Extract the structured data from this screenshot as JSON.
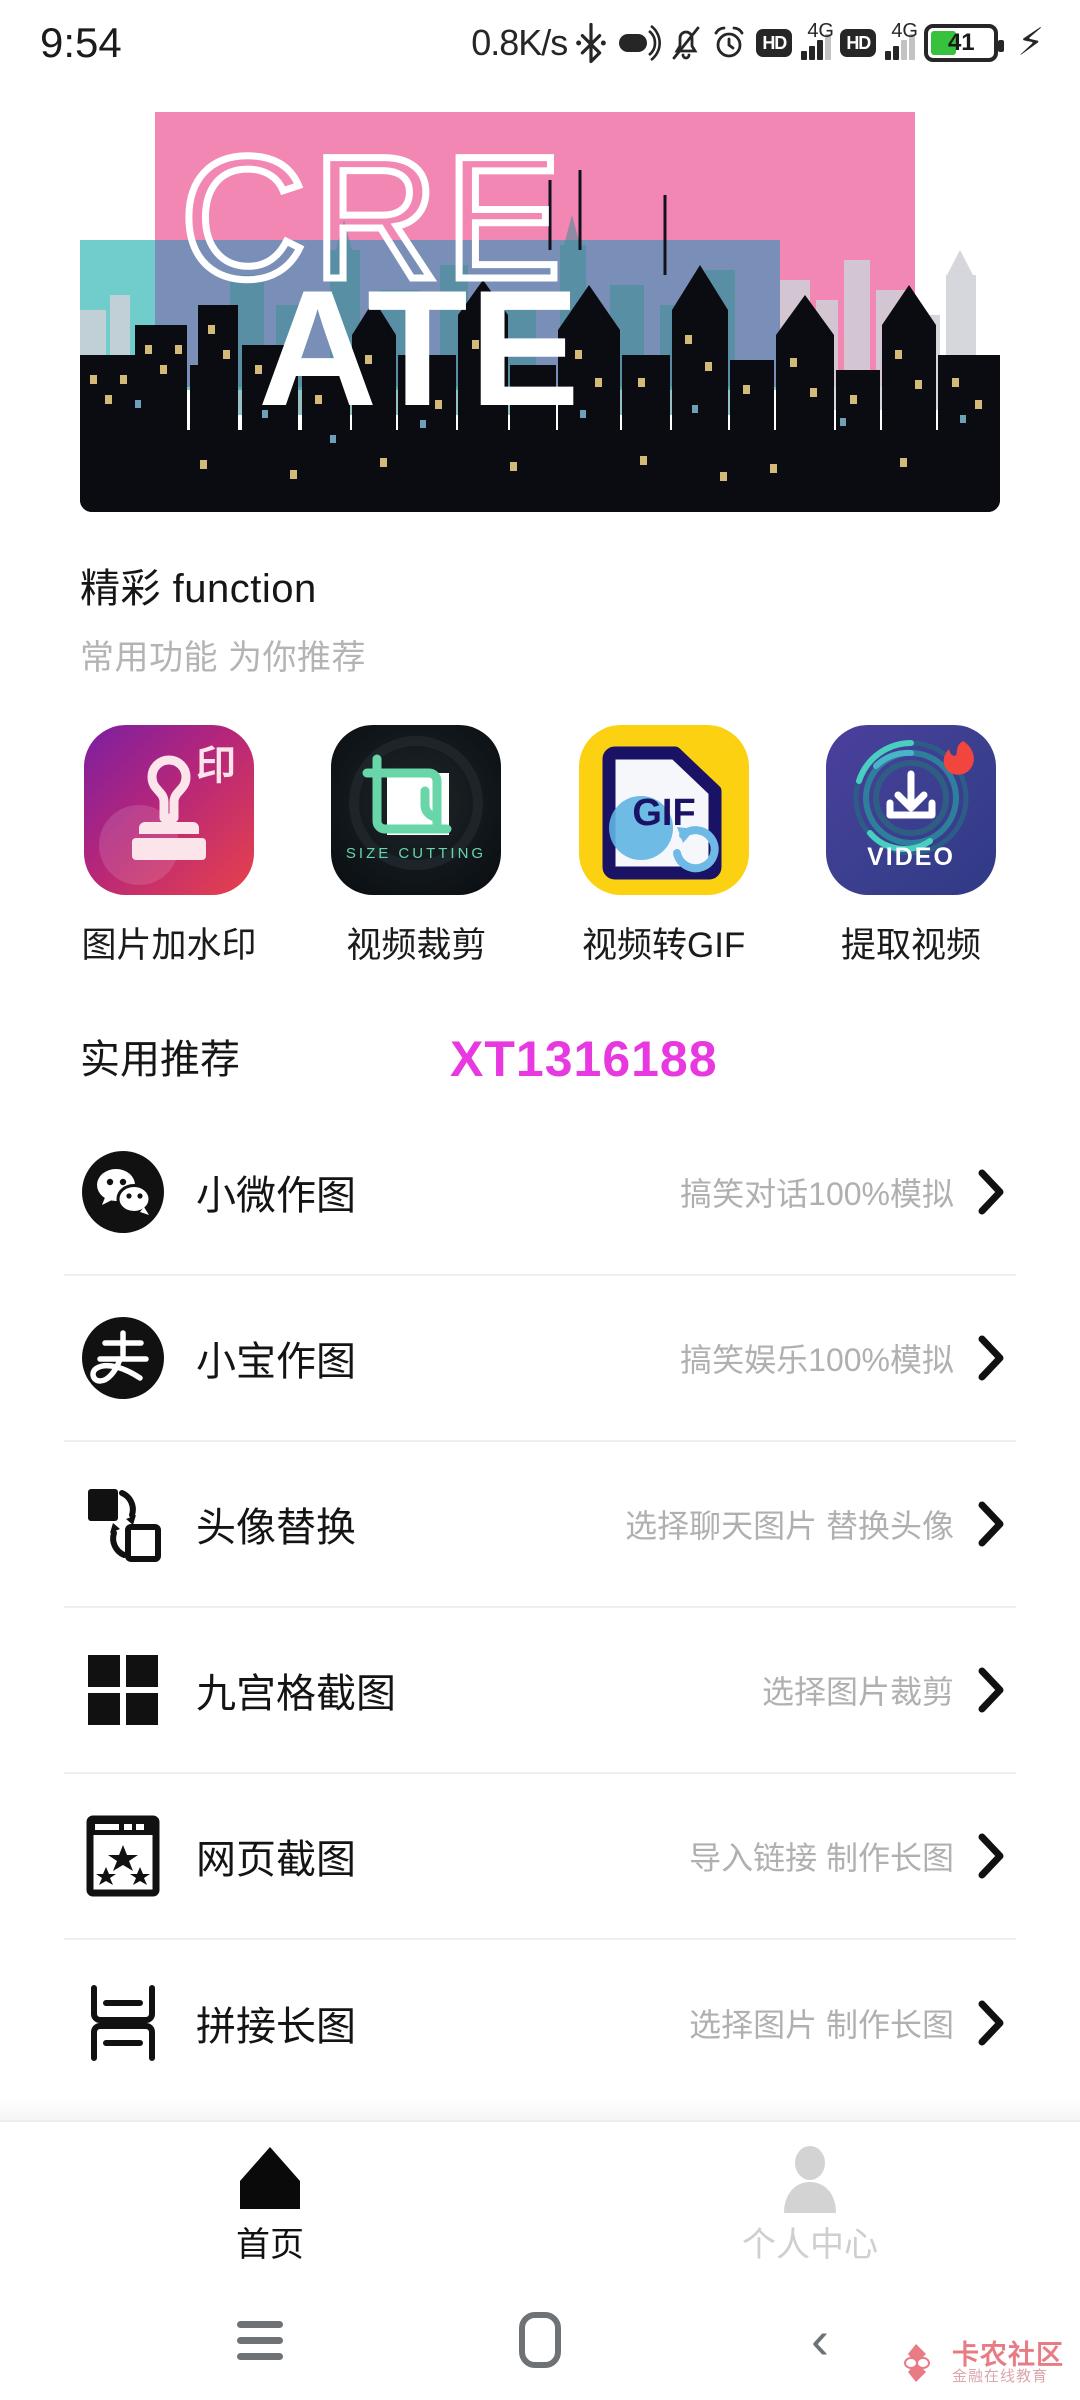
{
  "status_bar": {
    "time": "9:54",
    "network_speed": "0.8K/s",
    "bluetooth_icon": "bluetooth-icon",
    "capsule_icon": "data-saver-icon",
    "mute_icon": "mute-bell-icon",
    "alarm_icon": "alarm-clock-icon",
    "hd1_label": "HD",
    "net1_label": "4G",
    "hd2_label": "HD",
    "net2_label": "4G",
    "battery_percent": "41",
    "battery_level": 41,
    "battery_color": "#37c13c",
    "charging_icon": "lightning-bolt-icon"
  },
  "banner": {
    "name": "create-poster-banner",
    "line1": "CRE",
    "line2": "ATE",
    "pink_block_color": "#f287b4",
    "teal_block_color": "#62c6c6",
    "city_color": "#0b0b12"
  },
  "function_section": {
    "title": "精彩 function",
    "subtitle": "常用功能 为你推荐",
    "items": [
      {
        "label": "图片加水印",
        "icon": "stamp-watermark-icon",
        "badge": "印"
      },
      {
        "label": "视频裁剪",
        "icon": "crop-size-cutting-icon",
        "badge": "SIZE CUTTING"
      },
      {
        "label": "视频转GIF",
        "icon": "gif-convert-icon",
        "badge": "GIF"
      },
      {
        "label": "提取视频",
        "icon": "video-download-icon",
        "badge": "VIDEO"
      }
    ]
  },
  "recommend_section": {
    "title": "实用推荐",
    "watermark": "XT1316188",
    "watermark_color": "#e838e0",
    "items": [
      {
        "label": "小微作图",
        "desc": "搞笑对话100%模拟",
        "icon": "wechat-icon"
      },
      {
        "label": "小宝作图",
        "desc": "搞笑娱乐100%模拟",
        "icon": "alipay-icon"
      },
      {
        "label": "头像替换",
        "desc": "选择聊天图片 替换头像",
        "icon": "avatar-swap-icon"
      },
      {
        "label": "九宫格截图",
        "desc": "选择图片裁剪",
        "icon": "grid-nine-icon"
      },
      {
        "label": "网页截图",
        "desc": "导入链接 制作长图",
        "icon": "webpage-capture-icon"
      },
      {
        "label": "拼接长图",
        "desc": "选择图片 制作长图",
        "icon": "stitch-long-image-icon"
      }
    ]
  },
  "tabbar": {
    "tabs": [
      {
        "label": "首页",
        "icon": "home-icon",
        "active": true
      },
      {
        "label": "个人中心",
        "icon": "person-icon",
        "active": false
      }
    ]
  },
  "android_nav": {
    "recents_icon": "menu-lines-icon",
    "home_icon": "home-rect-icon",
    "back_icon": "back-chevron-icon"
  },
  "brandmark": {
    "main": "卡农社区",
    "sub": "金融在线教育",
    "color": "#e8707a"
  }
}
